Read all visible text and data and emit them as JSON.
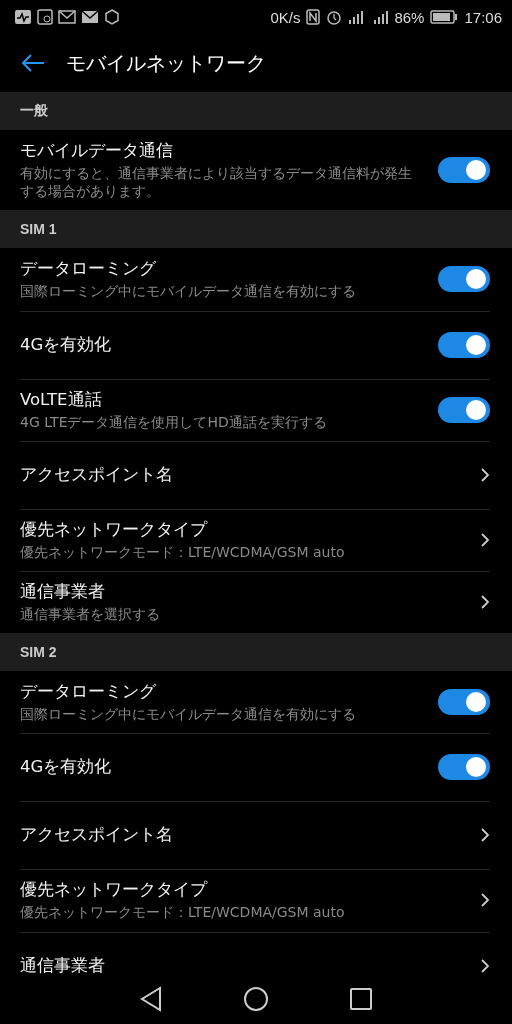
{
  "status_bar": {
    "speed": "0K/s",
    "battery": "86%",
    "time": "17:06"
  },
  "app_bar": {
    "title": "モバイルネットワーク"
  },
  "sections": [
    {
      "header": "一般",
      "rows": [
        {
          "kind": "toggle",
          "title": "モバイルデータ通信",
          "subtitle": "有効にすると、通信事業者により該当するデータ通信料が発生する場合があります。",
          "on": true
        }
      ]
    },
    {
      "header": "SIM 1",
      "rows": [
        {
          "kind": "toggle",
          "title": "データローミング",
          "subtitle": "国際ローミング中にモバイルデータ通信を有効にする",
          "on": true
        },
        {
          "kind": "toggle",
          "title": "4Gを有効化",
          "on": true
        },
        {
          "kind": "toggle",
          "title": "VoLTE通話",
          "subtitle": "4G LTEデータ通信を使用してHD通話を実行する",
          "on": true
        },
        {
          "kind": "link",
          "title": "アクセスポイント名"
        },
        {
          "kind": "link",
          "title": "優先ネットワークタイプ",
          "subtitle": "優先ネットワークモード：LTE/WCDMA/GSM auto"
        },
        {
          "kind": "link",
          "title": "通信事業者",
          "subtitle": "通信事業者を選択する"
        }
      ]
    },
    {
      "header": "SIM 2",
      "rows": [
        {
          "kind": "toggle",
          "title": "データローミング",
          "subtitle": "国際ローミング中にモバイルデータ通信を有効にする",
          "on": true
        },
        {
          "kind": "toggle",
          "title": "4Gを有効化",
          "on": true
        },
        {
          "kind": "link",
          "title": "アクセスポイント名"
        },
        {
          "kind": "link",
          "title": "優先ネットワークタイプ",
          "subtitle": "優先ネットワークモード：LTE/WCDMA/GSM auto"
        },
        {
          "kind": "link",
          "title": "通信事業者"
        }
      ]
    }
  ]
}
